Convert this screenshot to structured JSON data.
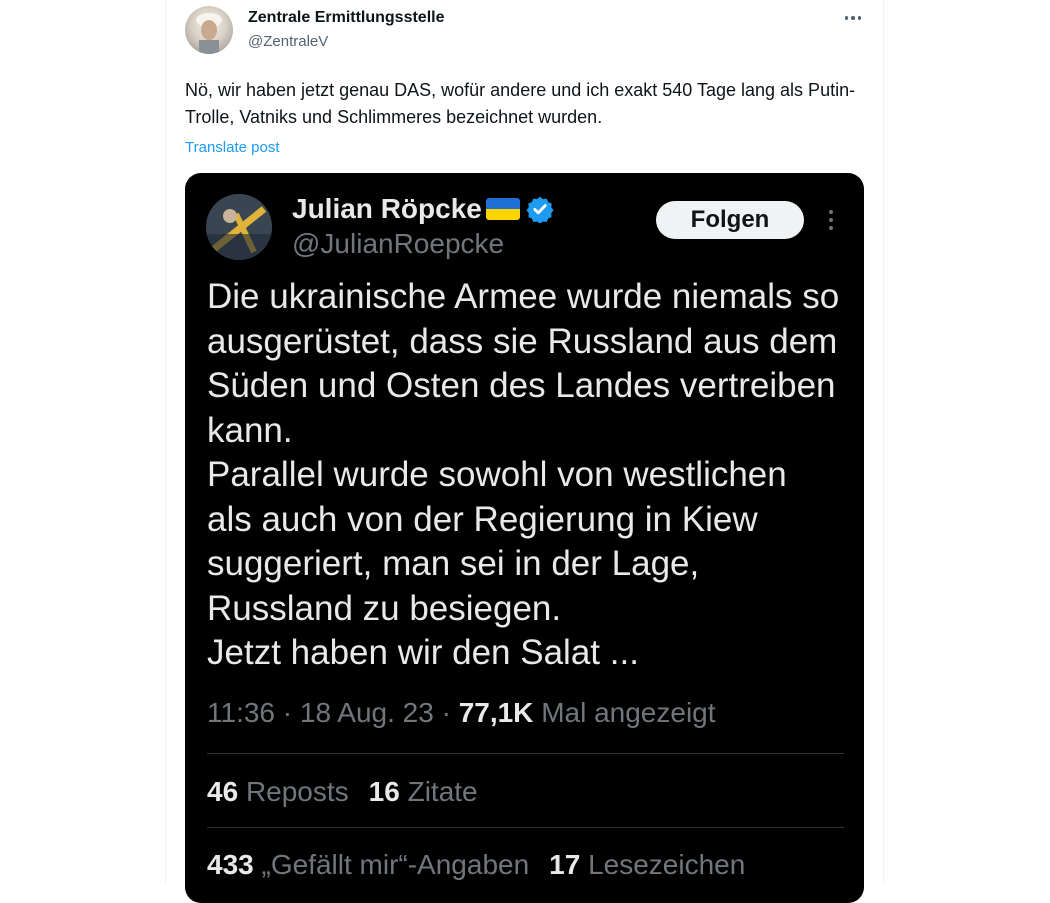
{
  "post": {
    "author_name": "Zentrale Ermittlungsstelle",
    "author_handle": "@ZentraleV",
    "text": "Nö, wir haben jetzt genau DAS, wofür andere und ich exakt 540 Tage lang als Putin-Trolle, Vatniks und Schlimmeres bezeichnet wurden.",
    "translate_label": "Translate post",
    "more_icon": "more-horizontal-icon"
  },
  "quoted": {
    "name": "Julian Röpcke",
    "handle": "@JulianRoepcke",
    "follow_label": "Folgen",
    "text_lines": [
      "Die ukrainische Armee wurde niemals so",
      "ausgerüstet, dass sie Russland aus dem",
      "Süden und Osten des Landes vertreiben",
      "kann.",
      "Parallel wurde sowohl von westlichen",
      "als auch von der Regierung in Kiew",
      "suggeriert, man sei in der Lage,",
      "Russland zu besiegen.",
      "Jetzt haben wir den Salat ..."
    ],
    "time": "11:36",
    "date": "18 Aug. 23",
    "views": "77,1K",
    "views_label": "Mal angezeigt",
    "reposts_count": "46",
    "reposts_label": "Reposts",
    "quotes_count": "16",
    "quotes_label": "Zitate",
    "likes_count": "433",
    "likes_label": "„Gefällt mir“-Angaben",
    "bookmarks_count": "17",
    "bookmarks_label": "Lesezeichen"
  },
  "colors": {
    "link": "#1d9bf0",
    "verified": "#1d9bf0",
    "flag_blue": "#1e6fd6",
    "flag_yellow": "#ffd400",
    "dark_bg": "#000000"
  }
}
